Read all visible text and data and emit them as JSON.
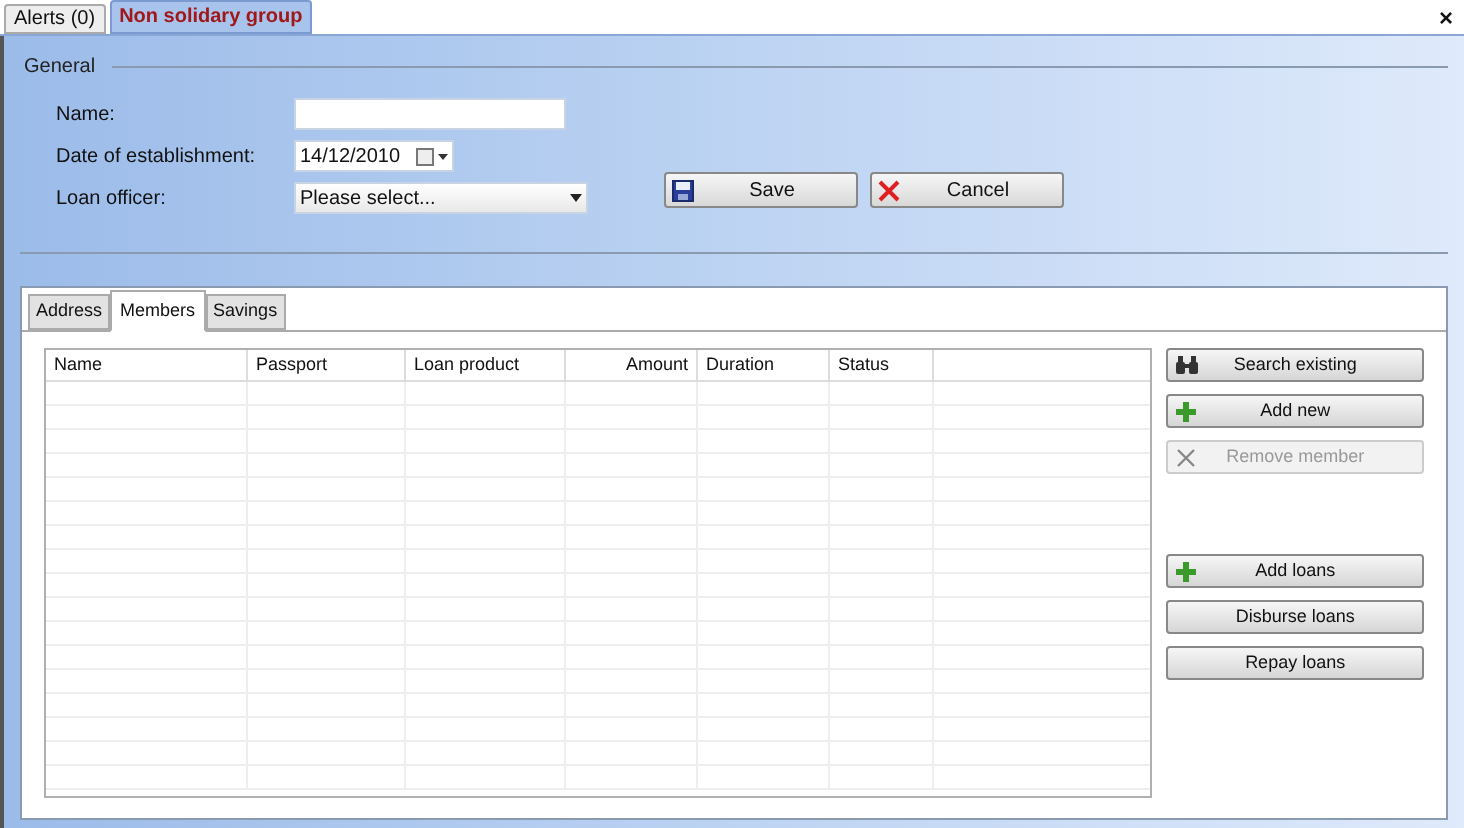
{
  "doc_tabs": [
    {
      "label": "Alerts (0)",
      "selected": false
    },
    {
      "label": "Non solidary group",
      "selected": true
    }
  ],
  "close": "×",
  "general": {
    "title": "General",
    "fields": [
      {
        "kind": "text",
        "label": "Name:"
      },
      {
        "kind": "date",
        "label": "Date of establishment:",
        "value": "14/12/2010"
      },
      {
        "kind": "select",
        "label": "Loan officer:",
        "value": "Please select..."
      }
    ]
  },
  "form_buttons": [
    {
      "label": "Save",
      "kind": "save"
    },
    {
      "label": "Cancel",
      "kind": "cancel"
    }
  ],
  "inner_tabs": [
    {
      "label": "Address",
      "selected": false
    },
    {
      "label": "Members",
      "selected": true
    },
    {
      "label": "Savings",
      "selected": false
    }
  ],
  "table": {
    "columns": [
      "Name",
      "Passport",
      "Loan product",
      "Amount",
      "Duration",
      "Status"
    ]
  },
  "member_buttons": [
    {
      "label": "Search existing",
      "kind": "search",
      "disabled": false
    },
    {
      "label": "Add new",
      "kind": "add",
      "disabled": false
    },
    {
      "label": "Remove member",
      "kind": "remove",
      "disabled": true
    },
    {
      "label": "Add loans",
      "kind": "add",
      "disabled": false
    },
    {
      "label": "Disburse loans",
      "kind": "plain",
      "disabled": false
    },
    {
      "label": "Repay loans",
      "kind": "plain",
      "disabled": false
    }
  ]
}
